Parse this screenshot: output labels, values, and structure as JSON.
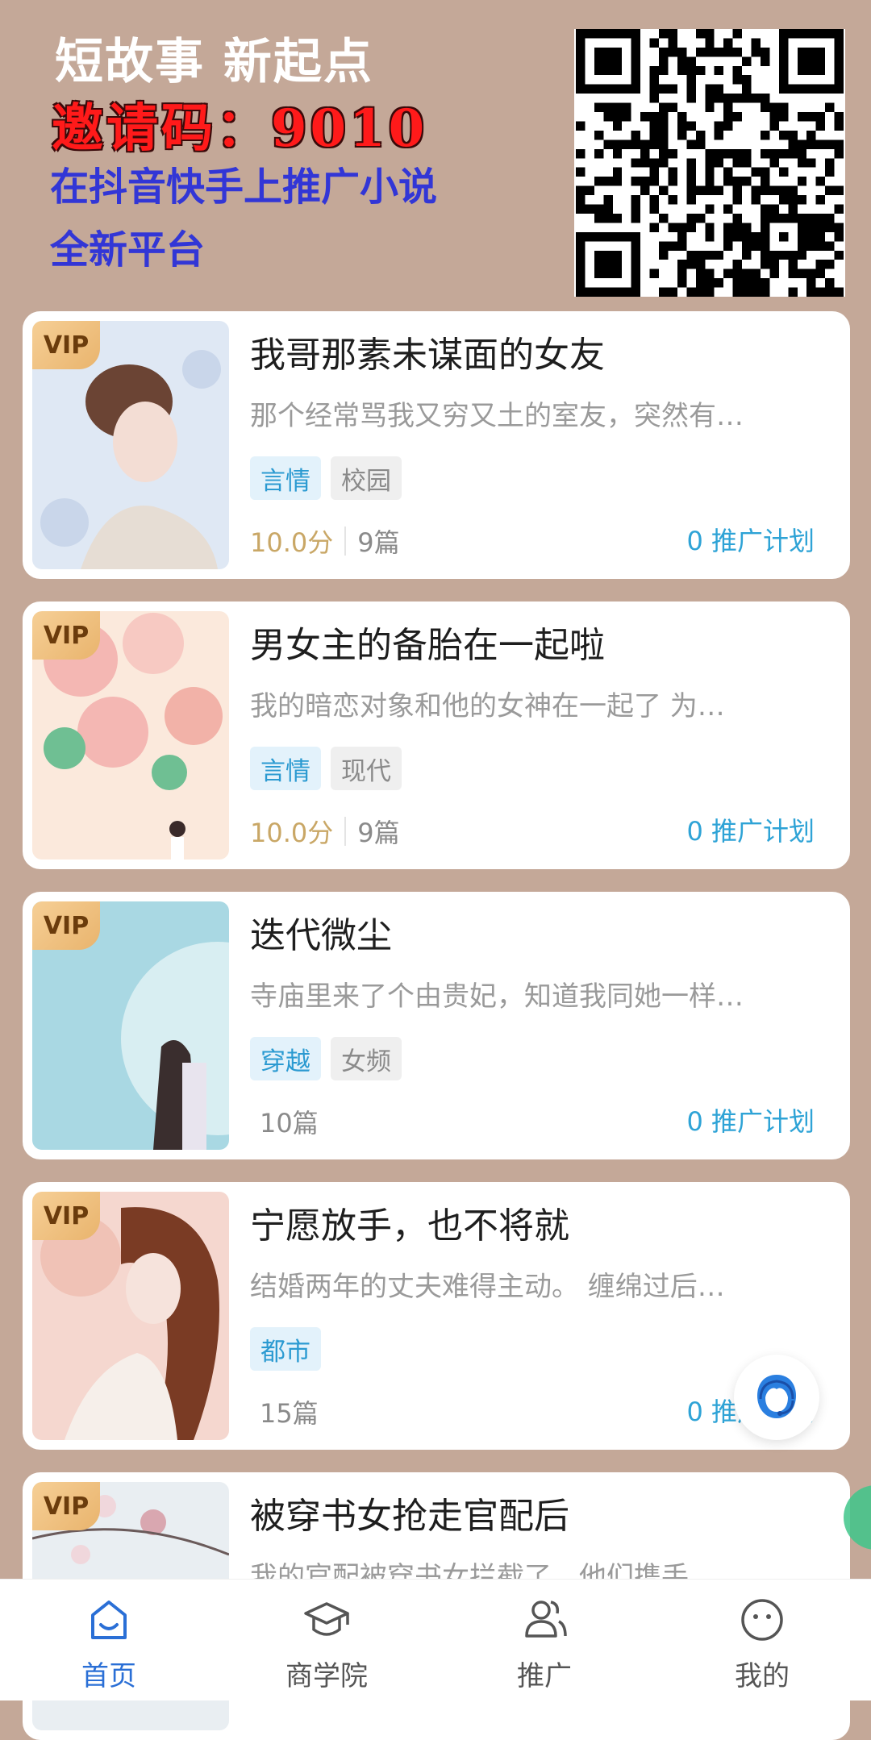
{
  "promo": {
    "title": "短故事 新起点",
    "invite_code": "邀请码：9010",
    "line1": "在抖音快手上推广小说",
    "line2": "全新平台"
  },
  "books": [
    {
      "vip": "VIP",
      "title": "我哥那素未谋面的女友",
      "desc": "那个经常骂我又穷又土的室友，突然有…",
      "tags": [
        "言情",
        "校园"
      ],
      "score": "10.0分",
      "count": "9篇",
      "plan": "0 推广计划",
      "cover_colors": [
        "#dfe8f4",
        "#c9d6ea",
        "#7a4a3a"
      ]
    },
    {
      "vip": "VIP",
      "title": "男女主的备胎在一起啦",
      "desc": "我的暗恋对象和他的女神在一起了 为…",
      "tags": [
        "言情",
        "现代"
      ],
      "score": "10.0分",
      "count": "9篇",
      "plan": "0 推广计划",
      "cover_colors": [
        "#fbe9dc",
        "#f4b7b3",
        "#6fbf93"
      ]
    },
    {
      "vip": "VIP",
      "title": "迭代微尘",
      "desc": "寺庙里来了个由贵妃，知道我同她一样…",
      "tags": [
        "穿越",
        "女频"
      ],
      "score": "",
      "count": "10篇",
      "plan": "0 推广计划",
      "cover_colors": [
        "#a9d8e3",
        "#d8eef2",
        "#4a3a3a"
      ]
    },
    {
      "vip": "VIP",
      "title": "宁愿放手，也不将就",
      "desc": "结婚两年的丈夫难得主动。 缠绵过后…",
      "tags": [
        "都市"
      ],
      "score": "",
      "count": "15篇",
      "plan": "0 推广计划",
      "cover_colors": [
        "#f5d7cf",
        "#f0c2b6",
        "#7a3b24"
      ]
    },
    {
      "vip": "VIP",
      "title": "被穿书女抢走官配后",
      "desc": "我的官配被穿书女拦截了，他们携手…",
      "tags": [],
      "score": "",
      "count": "",
      "plan": "",
      "cover_colors": [
        "#e9eef2",
        "#ffffff",
        "#d9a7b0"
      ]
    }
  ],
  "nav": {
    "items": [
      {
        "label": "首页",
        "icon": "home-icon",
        "active": true
      },
      {
        "label": "商学院",
        "icon": "graduation-cap-icon",
        "active": false
      },
      {
        "label": "推广",
        "icon": "users-icon",
        "active": false
      },
      {
        "label": "我的",
        "icon": "smiley-face-icon",
        "active": false
      }
    ]
  },
  "colors": {
    "page_bg": "#c4a898",
    "accent_blue": "#2ea3d6",
    "nav_active": "#2a6fd6",
    "score_gold": "#c9a766"
  },
  "floating": {
    "customer_service_icon": "customer-service-icon"
  }
}
